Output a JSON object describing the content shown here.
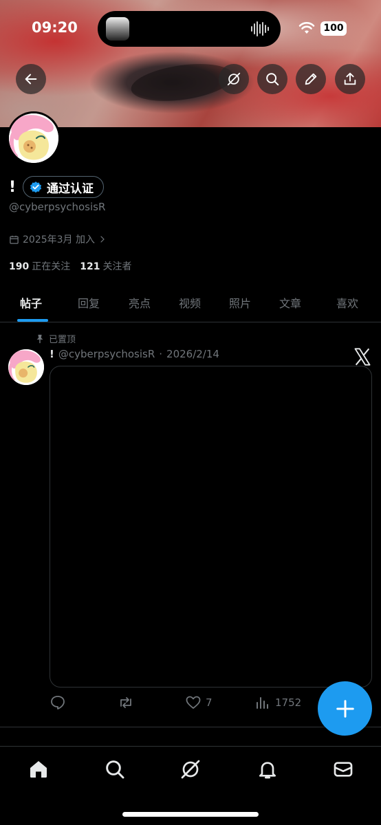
{
  "status_bar": {
    "time": "09:20",
    "battery": "100"
  },
  "profile": {
    "name": "!",
    "verified_label": "通过认证",
    "handle": "@cyberpsychosisR",
    "joined": "2025年3月 加入",
    "following_count": "190",
    "following_label": "正在关注",
    "followers_count": "121",
    "followers_label": "关注者"
  },
  "tabs": [
    {
      "label": "帖子",
      "active": true
    },
    {
      "label": "回复"
    },
    {
      "label": "亮点"
    },
    {
      "label": "视频"
    },
    {
      "label": "照片"
    },
    {
      "label": "文章"
    },
    {
      "label": "喜欢"
    }
  ],
  "post": {
    "pinned_label": "已置顶",
    "author_name": "!",
    "handle": "@cyberpsychosisR",
    "separator": "·",
    "date": "2026/2/14",
    "likes": "7",
    "views": "1752"
  },
  "icons": {
    "back": "arrow-left-icon",
    "grok": "grok-icon",
    "search": "search-icon",
    "edit": "pencil-icon",
    "share": "share-icon",
    "verified": "verified-badge-icon",
    "calendar": "calendar-icon",
    "pin": "pin-icon",
    "reply": "reply-icon",
    "retweet": "retweet-icon",
    "like": "heart-icon",
    "views": "views-icon",
    "compose": "plus-icon",
    "home": "home-icon",
    "notifications": "bell-icon",
    "messages": "mail-icon"
  },
  "colors": {
    "accent": "#1d9bf0",
    "background": "#000000",
    "secondary_text": "#71767b"
  }
}
